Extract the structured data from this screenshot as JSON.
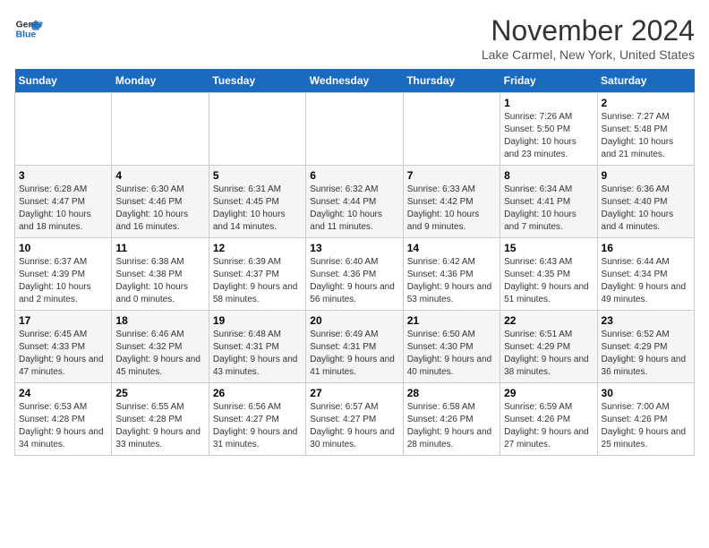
{
  "logo": {
    "line1": "General",
    "line2": "Blue"
  },
  "title": "November 2024",
  "location": "Lake Carmel, New York, United States",
  "days_of_week": [
    "Sunday",
    "Monday",
    "Tuesday",
    "Wednesday",
    "Thursday",
    "Friday",
    "Saturday"
  ],
  "weeks": [
    [
      {
        "day": "",
        "info": ""
      },
      {
        "day": "",
        "info": ""
      },
      {
        "day": "",
        "info": ""
      },
      {
        "day": "",
        "info": ""
      },
      {
        "day": "",
        "info": ""
      },
      {
        "day": "1",
        "info": "Sunrise: 7:26 AM\nSunset: 5:50 PM\nDaylight: 10 hours and 23 minutes."
      },
      {
        "day": "2",
        "info": "Sunrise: 7:27 AM\nSunset: 5:48 PM\nDaylight: 10 hours and 21 minutes."
      }
    ],
    [
      {
        "day": "3",
        "info": "Sunrise: 6:28 AM\nSunset: 4:47 PM\nDaylight: 10 hours and 18 minutes."
      },
      {
        "day": "4",
        "info": "Sunrise: 6:30 AM\nSunset: 4:46 PM\nDaylight: 10 hours and 16 minutes."
      },
      {
        "day": "5",
        "info": "Sunrise: 6:31 AM\nSunset: 4:45 PM\nDaylight: 10 hours and 14 minutes."
      },
      {
        "day": "6",
        "info": "Sunrise: 6:32 AM\nSunset: 4:44 PM\nDaylight: 10 hours and 11 minutes."
      },
      {
        "day": "7",
        "info": "Sunrise: 6:33 AM\nSunset: 4:42 PM\nDaylight: 10 hours and 9 minutes."
      },
      {
        "day": "8",
        "info": "Sunrise: 6:34 AM\nSunset: 4:41 PM\nDaylight: 10 hours and 7 minutes."
      },
      {
        "day": "9",
        "info": "Sunrise: 6:36 AM\nSunset: 4:40 PM\nDaylight: 10 hours and 4 minutes."
      }
    ],
    [
      {
        "day": "10",
        "info": "Sunrise: 6:37 AM\nSunset: 4:39 PM\nDaylight: 10 hours and 2 minutes."
      },
      {
        "day": "11",
        "info": "Sunrise: 6:38 AM\nSunset: 4:38 PM\nDaylight: 10 hours and 0 minutes."
      },
      {
        "day": "12",
        "info": "Sunrise: 6:39 AM\nSunset: 4:37 PM\nDaylight: 9 hours and 58 minutes."
      },
      {
        "day": "13",
        "info": "Sunrise: 6:40 AM\nSunset: 4:36 PM\nDaylight: 9 hours and 56 minutes."
      },
      {
        "day": "14",
        "info": "Sunrise: 6:42 AM\nSunset: 4:36 PM\nDaylight: 9 hours and 53 minutes."
      },
      {
        "day": "15",
        "info": "Sunrise: 6:43 AM\nSunset: 4:35 PM\nDaylight: 9 hours and 51 minutes."
      },
      {
        "day": "16",
        "info": "Sunrise: 6:44 AM\nSunset: 4:34 PM\nDaylight: 9 hours and 49 minutes."
      }
    ],
    [
      {
        "day": "17",
        "info": "Sunrise: 6:45 AM\nSunset: 4:33 PM\nDaylight: 9 hours and 47 minutes."
      },
      {
        "day": "18",
        "info": "Sunrise: 6:46 AM\nSunset: 4:32 PM\nDaylight: 9 hours and 45 minutes."
      },
      {
        "day": "19",
        "info": "Sunrise: 6:48 AM\nSunset: 4:31 PM\nDaylight: 9 hours and 43 minutes."
      },
      {
        "day": "20",
        "info": "Sunrise: 6:49 AM\nSunset: 4:31 PM\nDaylight: 9 hours and 41 minutes."
      },
      {
        "day": "21",
        "info": "Sunrise: 6:50 AM\nSunset: 4:30 PM\nDaylight: 9 hours and 40 minutes."
      },
      {
        "day": "22",
        "info": "Sunrise: 6:51 AM\nSunset: 4:29 PM\nDaylight: 9 hours and 38 minutes."
      },
      {
        "day": "23",
        "info": "Sunrise: 6:52 AM\nSunset: 4:29 PM\nDaylight: 9 hours and 36 minutes."
      }
    ],
    [
      {
        "day": "24",
        "info": "Sunrise: 6:53 AM\nSunset: 4:28 PM\nDaylight: 9 hours and 34 minutes."
      },
      {
        "day": "25",
        "info": "Sunrise: 6:55 AM\nSunset: 4:28 PM\nDaylight: 9 hours and 33 minutes."
      },
      {
        "day": "26",
        "info": "Sunrise: 6:56 AM\nSunset: 4:27 PM\nDaylight: 9 hours and 31 minutes."
      },
      {
        "day": "27",
        "info": "Sunrise: 6:57 AM\nSunset: 4:27 PM\nDaylight: 9 hours and 30 minutes."
      },
      {
        "day": "28",
        "info": "Sunrise: 6:58 AM\nSunset: 4:26 PM\nDaylight: 9 hours and 28 minutes."
      },
      {
        "day": "29",
        "info": "Sunrise: 6:59 AM\nSunset: 4:26 PM\nDaylight: 9 hours and 27 minutes."
      },
      {
        "day": "30",
        "info": "Sunrise: 7:00 AM\nSunset: 4:26 PM\nDaylight: 9 hours and 25 minutes."
      }
    ]
  ]
}
